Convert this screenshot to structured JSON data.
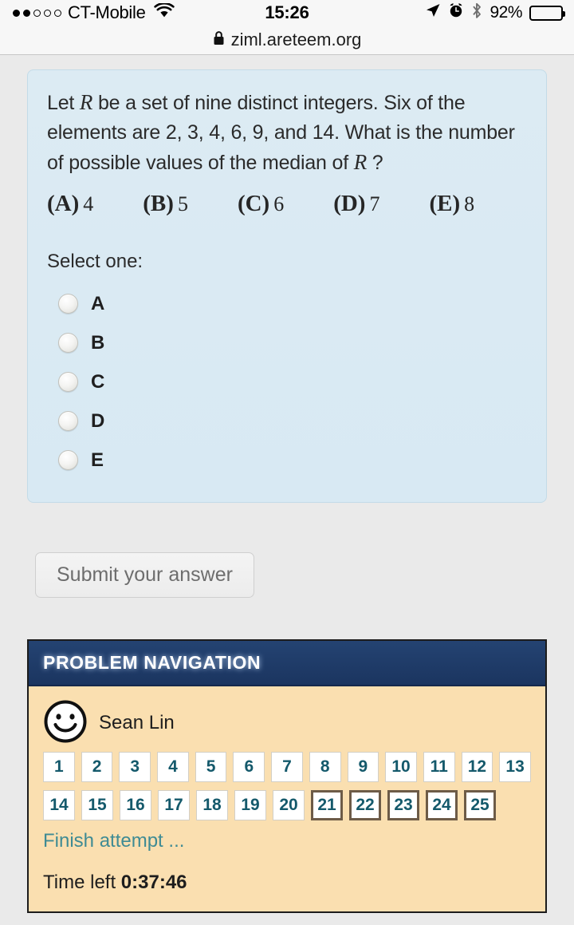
{
  "status_bar": {
    "carrier": "CT-Mobile",
    "signal_filled": 2,
    "signal_total": 5,
    "wifi_icon": "wifi-icon",
    "time": "15:26",
    "location_icon": "location-arrow-icon",
    "alarm_icon": "alarm-clock-icon",
    "bluetooth_icon": "bluetooth-icon",
    "battery_percent": "92%",
    "battery_level": 92
  },
  "url_bar": {
    "lock_icon": "lock-icon",
    "url": "ziml.areteem.org"
  },
  "question": {
    "text_part1": "Let ",
    "variable1": "R",
    "text_part2": " be a set of nine distinct integers. Six of the elements are 2, 3, 4, 6, 9, and 14. What is the number of possible values of the median of ",
    "variable2": "R",
    "text_part3": " ?",
    "choices": [
      {
        "label": "(A)",
        "value": "4"
      },
      {
        "label": "(B)",
        "value": "5"
      },
      {
        "label": "(C)",
        "value": "6"
      },
      {
        "label": "(D)",
        "value": "7"
      },
      {
        "label": "(E)",
        "value": "8"
      }
    ],
    "select_prompt": "Select one:",
    "options": [
      {
        "label": "A",
        "selected": false
      },
      {
        "label": "B",
        "selected": false
      },
      {
        "label": "C",
        "selected": false
      },
      {
        "label": "D",
        "selected": false
      },
      {
        "label": "E",
        "selected": false
      }
    ]
  },
  "submit": {
    "label": "Submit your answer"
  },
  "navigation": {
    "header": "PROBLEM NAVIGATION",
    "avatar_icon": "smiley-face-avatar-icon",
    "user_name": "Sean Lin",
    "rows": [
      [
        {
          "number": "1",
          "flagged": false
        },
        {
          "number": "2",
          "flagged": false
        },
        {
          "number": "3",
          "flagged": false
        },
        {
          "number": "4",
          "flagged": false
        },
        {
          "number": "5",
          "flagged": false
        },
        {
          "number": "6",
          "flagged": false
        },
        {
          "number": "7",
          "flagged": false
        },
        {
          "number": "8",
          "flagged": false
        },
        {
          "number": "9",
          "flagged": false
        },
        {
          "number": "10",
          "flagged": false
        },
        {
          "number": "11",
          "flagged": false
        },
        {
          "number": "12",
          "flagged": false
        },
        {
          "number": "13",
          "flagged": false
        }
      ],
      [
        {
          "number": "14",
          "flagged": false
        },
        {
          "number": "15",
          "flagged": false
        },
        {
          "number": "16",
          "flagged": false
        },
        {
          "number": "17",
          "flagged": false
        },
        {
          "number": "18",
          "flagged": false
        },
        {
          "number": "19",
          "flagged": false
        },
        {
          "number": "20",
          "flagged": false
        },
        {
          "number": "21",
          "flagged": true
        },
        {
          "number": "22",
          "flagged": true
        },
        {
          "number": "23",
          "flagged": true
        },
        {
          "number": "24",
          "flagged": true
        },
        {
          "number": "25",
          "flagged": true
        }
      ]
    ],
    "finish_link": "Finish attempt ...",
    "time_label": "Time left ",
    "time_value": "0:37:46"
  },
  "colors": {
    "page_background": "#eaeaea",
    "question_background": "#dbeaf3",
    "nav_header": "#1f3d6b",
    "nav_body": "#fadfb0",
    "qbtn_text": "#14596b",
    "flagged_border": "#6d5b47",
    "link_teal": "#3f8b94"
  }
}
